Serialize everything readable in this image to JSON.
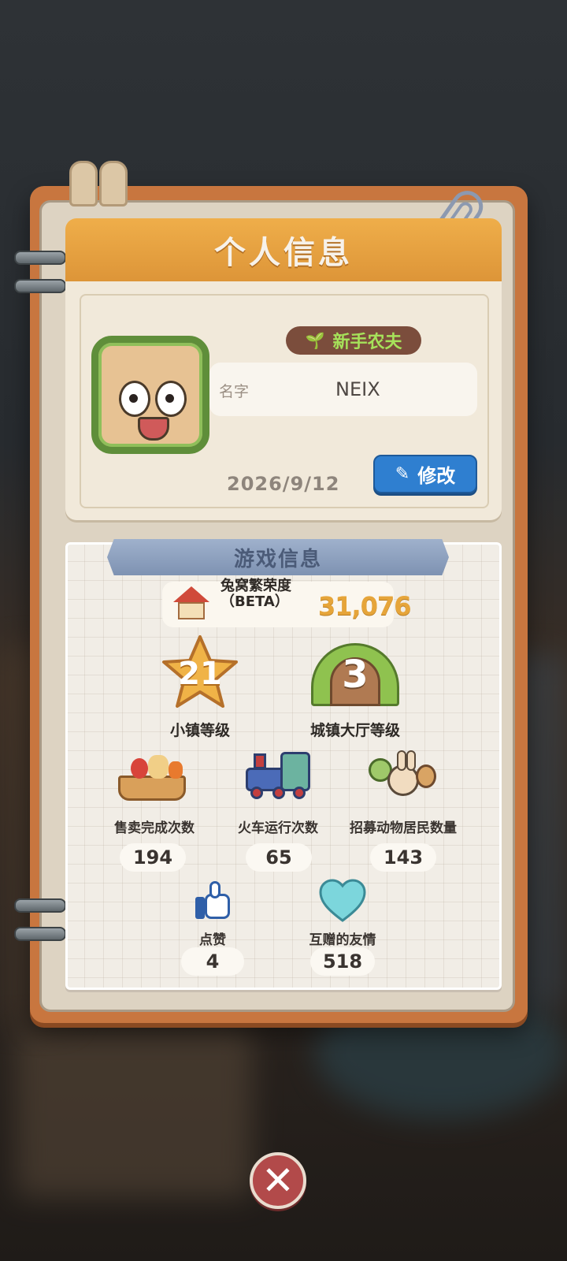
{
  "profile": {
    "header_title": "个人信息",
    "rank_badge": "新手农夫",
    "name_label": "名字",
    "name_value": "NEIX",
    "date": "2026/9/12",
    "edit_label": "修改"
  },
  "game_info": {
    "section_title": "游戏信息",
    "prosperity_label": "兔窝繁荣度（BETA）",
    "prosperity_value": "31,076",
    "town_level": {
      "value": "21",
      "label": "小镇等级"
    },
    "hall_level": {
      "value": "3",
      "label": "城镇大厅等级"
    },
    "stats": [
      {
        "label": "售卖完成次数",
        "value": "194",
        "icon": "market-basket-icon"
      },
      {
        "label": "火车运行次数",
        "value": "65",
        "icon": "train-icon"
      },
      {
        "label": "招募动物居民数量",
        "value": "143",
        "icon": "animal-residents-icon"
      }
    ],
    "likes": {
      "label": "点赞",
      "value": "4",
      "icon": "thumbs-up-icon"
    },
    "friendship": {
      "label": "互赠的友情",
      "value": "518",
      "icon": "heart-icon"
    }
  },
  "colors": {
    "header_orange": "#e9a443",
    "edit_blue": "#2f7fd0",
    "badge_brown": "#7b4d3c",
    "badge_green": "#a6e25a",
    "prosperity_gold": "#e6a53a",
    "close_red": "#b24a4a"
  }
}
